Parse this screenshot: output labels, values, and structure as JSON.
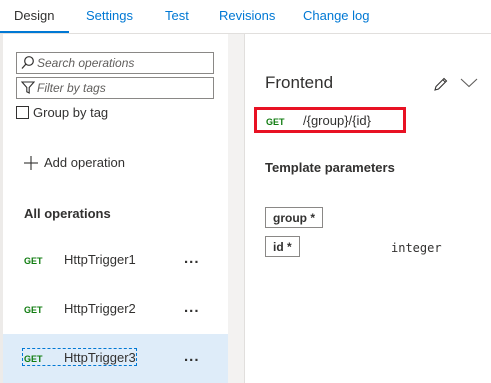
{
  "tabs": [
    {
      "label": "Design",
      "active": true
    },
    {
      "label": "Settings"
    },
    {
      "label": "Test"
    },
    {
      "label": "Revisions"
    },
    {
      "label": "Change log"
    }
  ],
  "sidebar": {
    "search": {
      "placeholder": "Search operations",
      "icon": "search-icon"
    },
    "filter": {
      "placeholder": "Filter by tags",
      "icon": "filter-icon"
    },
    "group_by_tag": {
      "label": "Group by tag",
      "checked": false
    },
    "add_operation": {
      "label": "Add operation",
      "icon": "plus-icon"
    },
    "all_operations_label": "All operations",
    "operations": [
      {
        "method": "GET",
        "name": "HttpTrigger1",
        "more": "..."
      },
      {
        "method": "GET",
        "name": "HttpTrigger2",
        "more": "..."
      },
      {
        "method": "GET",
        "name": "HttpTrigger3",
        "more": "...",
        "selected": true
      }
    ]
  },
  "frontend": {
    "title": "Frontend",
    "method": "GET",
    "url": "/{group}/{id}",
    "template_parameters_title": "Template parameters",
    "parameters": [
      {
        "name": "group *",
        "type": ""
      },
      {
        "name": "id *",
        "type": "integer"
      }
    ]
  },
  "colors": {
    "accent": "#0078d4",
    "method_get": "#107c10",
    "highlight_border": "#e81123",
    "selected_row": "#deecf9"
  }
}
